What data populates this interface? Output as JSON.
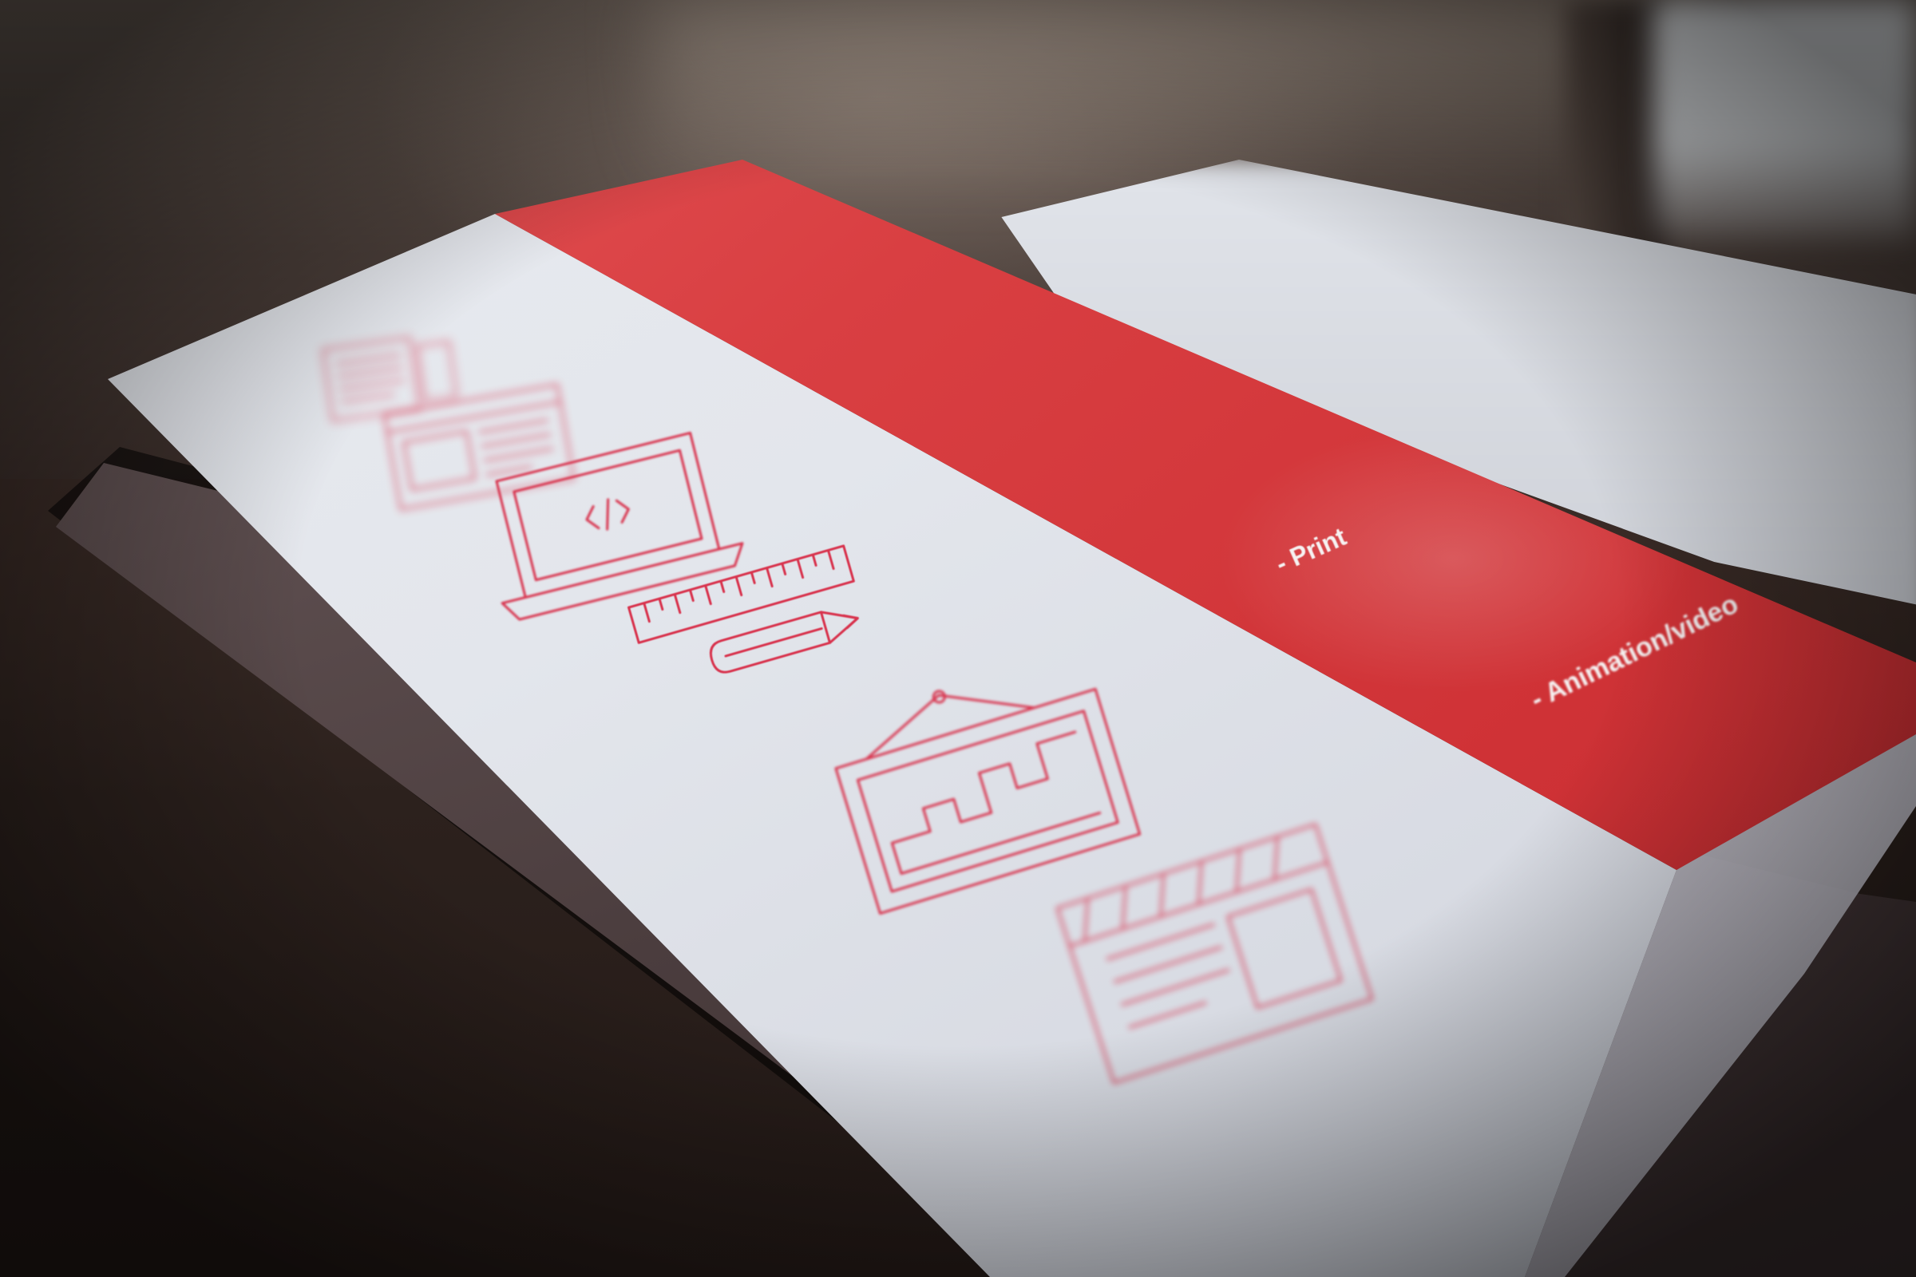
{
  "scene": {
    "colors": {
      "band_red": "#d93f42",
      "icon_red": "#d8334d",
      "page_white": "#e6e8ee",
      "table_brown": "#2c211d"
    }
  },
  "brochure": {
    "services": [
      {
        "label": ""
      },
      {
        "label": ""
      },
      {
        "label": ""
      },
      {
        "label": ""
      },
      {
        "label": "- Print"
      },
      {
        "label": "- Animation/video"
      }
    ],
    "icons": [
      {
        "name": "document-list-icon"
      },
      {
        "name": "web-layout-icon"
      },
      {
        "name": "laptop-code-icon"
      },
      {
        "name": "ruler-pencil-icon"
      },
      {
        "name": "framed-picture-icon"
      },
      {
        "name": "film-clapperboard-icon"
      }
    ]
  }
}
